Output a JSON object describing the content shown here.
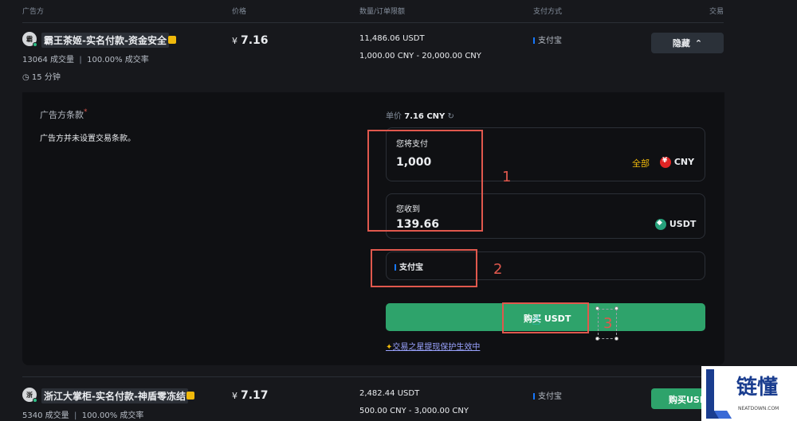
{
  "table_header": {
    "advertiser": "广告方",
    "price": "价格",
    "quantity_limit": "数量/订单限额",
    "payment": "支付方式",
    "trade": "交易"
  },
  "ad1": {
    "avatar_text": "霸",
    "name": "霸王茶姬-实名付款-资金安全",
    "trades": "13064 成交量",
    "completion": "100.00% 成交率",
    "time": "15 分钟",
    "price_currency": "¥",
    "price": "7.16",
    "quantity": "11,486.06 USDT",
    "limit": "1,000.00 CNY - 20,000.00 CNY",
    "payment": "支付宝",
    "hide_label": "隐藏"
  },
  "panel": {
    "terms_title": "广告方条款",
    "required_mark": "*",
    "terms_text": "广告方并未设置交易条款。",
    "unit_price_label": "单价",
    "unit_price": "7.16 CNY",
    "pay_label": "您将支付",
    "pay_value": "1,000",
    "all_label": "全部",
    "pay_currency": "CNY",
    "receive_label": "您收到",
    "receive_value": "139.66",
    "receive_currency": "USDT",
    "payment_method": "支付宝",
    "buy_label": "购买 USDT",
    "protection_text": "交易之星提现保护生效中"
  },
  "annotations": {
    "step1": "1",
    "step2": "2",
    "step3": "3"
  },
  "ad2": {
    "avatar_text": "浙",
    "name": "浙江大掌柜-实名付款-神盾零冻结",
    "trades": "5340 成交量",
    "completion": "100.00% 成交率",
    "price_currency": "¥",
    "price": "7.17",
    "quantity": "2,482.44 USDT",
    "limit": "500.00 CNY - 3,000.00 CNY",
    "payment": "支付宝",
    "buy_label": "购买USD"
  },
  "watermark": {
    "brand": "链懂",
    "domain": "NEATDOWN.COM"
  },
  "colors": {
    "background": "#17181c",
    "panel": "#0f1013",
    "buy_green": "#2ea36b",
    "annotation_red": "#e0584d",
    "all_gold": "#f0b90b",
    "pay_blue": "#1677ff"
  }
}
